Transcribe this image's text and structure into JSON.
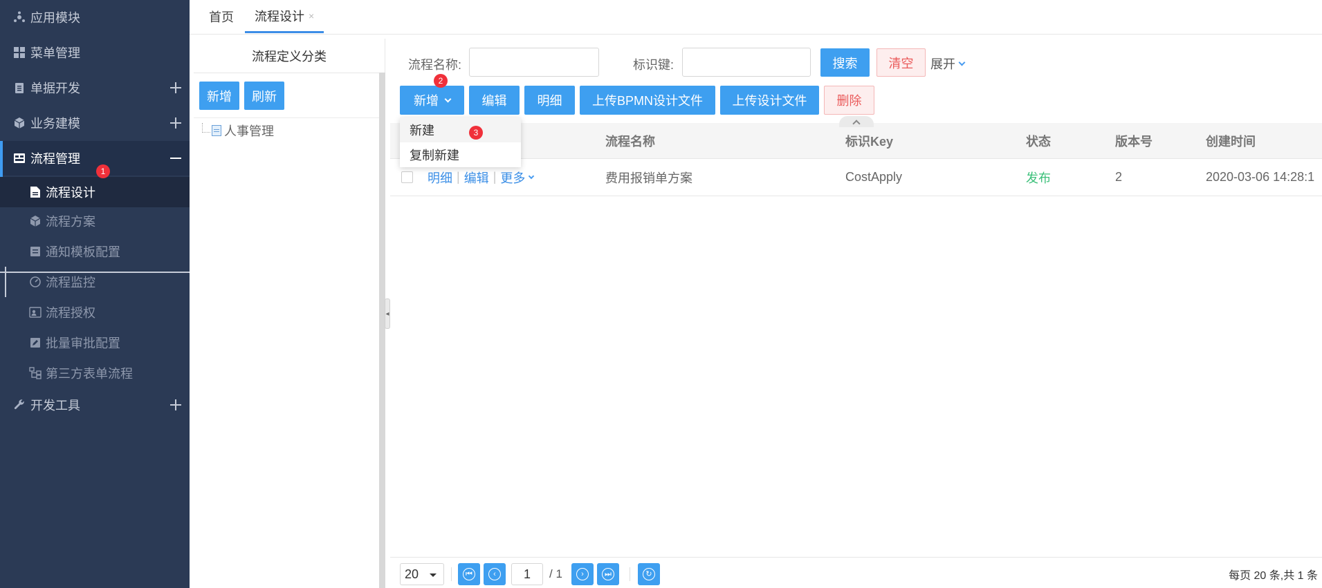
{
  "sidebar": {
    "items": [
      {
        "label": "应用模块",
        "icon": "cluster-icon",
        "top": 0
      },
      {
        "label": "菜单管理",
        "icon": "grid-icon"
      },
      {
        "label": "单据开发",
        "icon": "clipboard-icon"
      },
      {
        "label": "业务建模",
        "icon": "cube-icon"
      },
      {
        "label": "流程管理",
        "icon": "workflow-icon"
      },
      {
        "label": "开发工具",
        "icon": "wrench-icon"
      }
    ],
    "subitems": [
      {
        "label": "流程设计",
        "icon": "document-icon"
      },
      {
        "label": "流程方案",
        "icon": "cube-icon"
      },
      {
        "label": "通知模板配置",
        "icon": "template-icon"
      },
      {
        "label": "流程监控",
        "icon": "gauge-icon"
      },
      {
        "label": "流程授权",
        "icon": "user-card-icon"
      },
      {
        "label": "批量审批配置",
        "icon": "edit-icon"
      },
      {
        "label": "第三方表单流程",
        "icon": "hierarchy-icon"
      }
    ]
  },
  "badges": {
    "one": "1",
    "two": "2",
    "three": "3"
  },
  "tabs": [
    {
      "label": "首页"
    },
    {
      "label": "流程设计",
      "close": "×"
    }
  ],
  "tree": {
    "title": "流程定义分类",
    "add_label": "新增",
    "refresh_label": "刷新",
    "node_label": "人事管理"
  },
  "search": {
    "name_label": "流程名称:",
    "key_label": "标识键:",
    "search_label": "搜索",
    "clear_label": "清空",
    "expand_label": "展开"
  },
  "toolbar": {
    "add_label": "新增",
    "edit_label": "编辑",
    "detail_label": "明细",
    "upload_bpmn_label": "上传BPMN设计文件",
    "upload_design_label": "上传设计文件",
    "delete_label": "删除"
  },
  "dropdown": {
    "items": [
      "新建",
      "复制新建"
    ]
  },
  "table": {
    "headers": [
      "流程名称",
      "标识Key",
      "状态",
      "版本号",
      "创建时间"
    ],
    "rows": [
      {
        "actions": [
          "明细",
          "编辑",
          "更多"
        ],
        "name": "费用报销单方案",
        "key": "CostApply",
        "status": "发布",
        "version": "2",
        "created": "2020-03-06 14:28:1"
      }
    ]
  },
  "pager": {
    "page_size": "20",
    "current_page": "1",
    "total_pages": "/ 1",
    "summary": "每页 20 条,共 1 条"
  },
  "colors": {
    "sidebar_bg": "#2b3a55",
    "primary": "#3e9ff0",
    "danger": "#ea5a5a",
    "success": "#3cc07a",
    "badge": "#f0303a"
  }
}
